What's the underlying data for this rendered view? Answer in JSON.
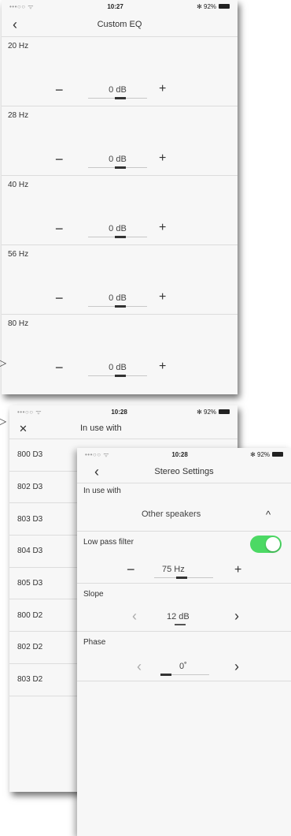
{
  "screen1": {
    "status": {
      "signal": "•••○○ ᯤ",
      "time": "10:27",
      "battery": "✻ 92%"
    },
    "nav": {
      "back": "‹",
      "title": "Custom EQ"
    },
    "bands": [
      {
        "label": "20 Hz",
        "value": "0 dB",
        "minus": "−",
        "plus": "+"
      },
      {
        "label": "28 Hz",
        "value": "0 dB",
        "minus": "−",
        "plus": "+"
      },
      {
        "label": "40 Hz",
        "value": "0 dB",
        "minus": "−",
        "plus": "+"
      },
      {
        "label": "56 Hz",
        "value": "0 dB",
        "minus": "−",
        "plus": "+"
      },
      {
        "label": "80 Hz",
        "value": "0 dB",
        "minus": "−",
        "plus": "+"
      }
    ]
  },
  "screen2": {
    "status": {
      "signal": "•••○○ ᯤ",
      "time": "10:28",
      "battery": "✻ 92%"
    },
    "nav": {
      "close": "✕",
      "title": "In use with"
    },
    "models": [
      "800 D3",
      "802 D3",
      "803 D3",
      "804 D3",
      "805 D3",
      "800 D2",
      "802 D2",
      "803 D2"
    ]
  },
  "screen3": {
    "status": {
      "signal": "•••○○ ᯤ",
      "time": "10:28",
      "battery": "✻ 92%"
    },
    "nav": {
      "back": "‹",
      "title": "Stereo Settings"
    },
    "in_use_with": {
      "label": "In use with",
      "value": "Other speakers",
      "chevron": "^"
    },
    "low_pass": {
      "label": "Low pass filter",
      "enabled": true,
      "minus": "−",
      "value": "75 Hz",
      "plus": "+"
    },
    "slope": {
      "label": "Slope",
      "prev": "‹",
      "value": "12 dB",
      "next": "›"
    },
    "phase": {
      "label": "Phase",
      "prev": "‹",
      "value": "0˚",
      "next": "›"
    }
  },
  "connectors": {
    "arrow": "▷"
  },
  "colors": {
    "toggle_on": "#4cd964",
    "background": "#f7f7f7"
  }
}
